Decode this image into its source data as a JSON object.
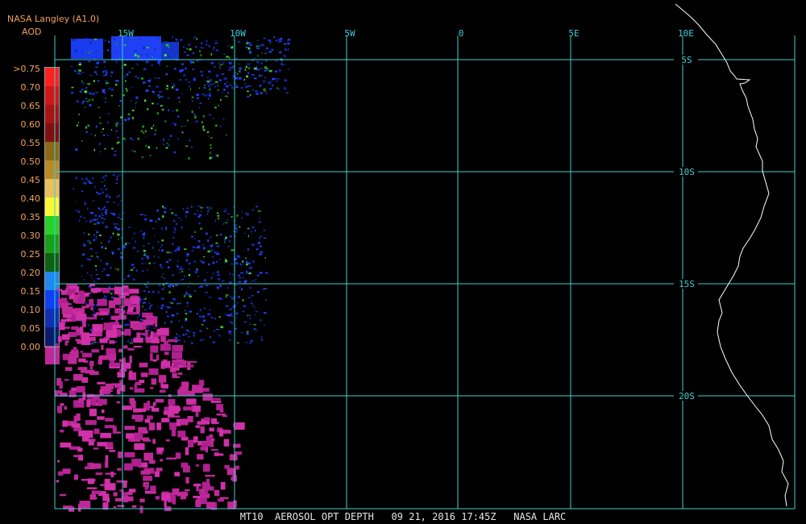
{
  "header": {
    "title": "NASA Langley (A1.0)",
    "unit": "AOD"
  },
  "legend": {
    "labels": [
      ">0.75",
      "0.70",
      "0.65",
      "0.60",
      "0.55",
      "0.50",
      "0.45",
      "0.40",
      "0.35",
      "0.30",
      "0.25",
      "0.20",
      "0.15",
      "0.10",
      "0.05",
      "0.00"
    ],
    "colors": [
      "#ff2020",
      "#d01818",
      "#a81414",
      "#801010",
      "#8a6a18",
      "#b88a28",
      "#e8c060",
      "#f8f838",
      "#28d028",
      "#18a018",
      "#106010",
      "#2088f0",
      "#1040f0",
      "#1030b0",
      "#0c1c6c",
      "#c02898"
    ]
  },
  "axes": {
    "lon_labels": [
      "15W",
      "10W",
      "5W",
      "0",
      "5E",
      "10E"
    ],
    "lat_labels": [
      "5S",
      "10S",
      "15S",
      "20S"
    ],
    "grid_color": "#40d0d0",
    "coast_color": "#ffffff"
  },
  "footer": {
    "caption": "MT10  AEROSOL OPT DEPTH   09 21, 2016 17:45Z   NASA LARC"
  }
}
